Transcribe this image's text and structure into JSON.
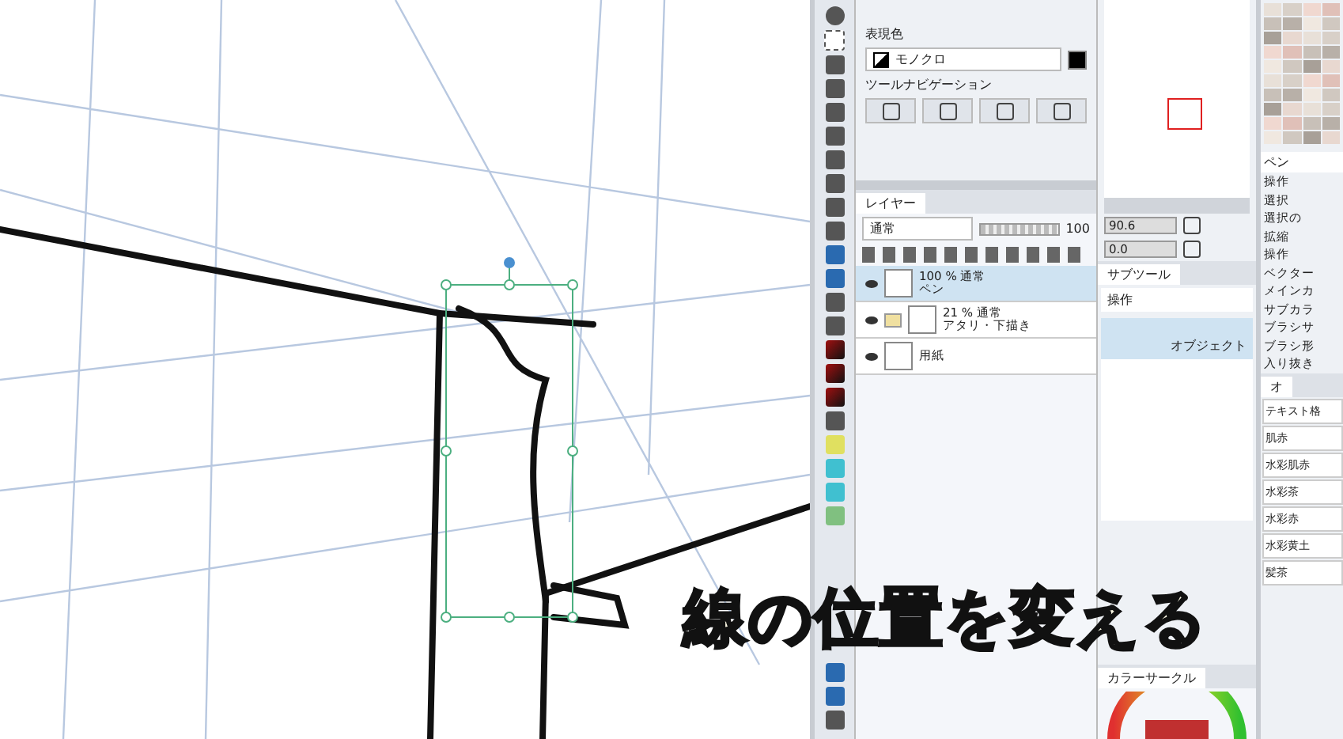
{
  "color_panel": {
    "label": "表現色",
    "mode": "モノクロ",
    "navigation_label": "ツールナビゲーション"
  },
  "layer_panel": {
    "tab": "レイヤー",
    "blend_mode": "通常",
    "opacity": "100",
    "layers": [
      {
        "kind": "raster",
        "visible": true,
        "selected": true,
        "opacity": "100 %",
        "blend": "通常",
        "name": "ペン"
      },
      {
        "kind": "folder",
        "visible": true,
        "selected": false,
        "opacity": "21 %",
        "blend": "通常",
        "name": "アタリ・下描き"
      },
      {
        "kind": "paper",
        "visible": true,
        "selected": false,
        "name": "用紙"
      }
    ]
  },
  "navigator": {
    "zoom": "90.6",
    "rotation": "0.0"
  },
  "sub_tool_panel": {
    "tab": "サブツール",
    "group": "操作",
    "items": [
      {
        "label": "オブジェクト",
        "selected": true
      }
    ]
  },
  "tool_property": {
    "tool": "ペン",
    "rows": [
      "操作",
      "選択",
      "選択の",
      "拡縮",
      "操作",
      "ベクター",
      "メインカ",
      "サブカラ",
      "ブラシサ",
      "ブラシ形",
      "入り抜き"
    ]
  },
  "material_panel": {
    "tab": "オ",
    "items": [
      "テキスト格",
      "肌赤",
      "水彩肌赤",
      "水彩茶",
      "水彩赤",
      "水彩黄土",
      "髪茶"
    ]
  },
  "color_circle_panel": {
    "tab": "カラーサークル"
  },
  "subtitle": "線の位置を変える"
}
